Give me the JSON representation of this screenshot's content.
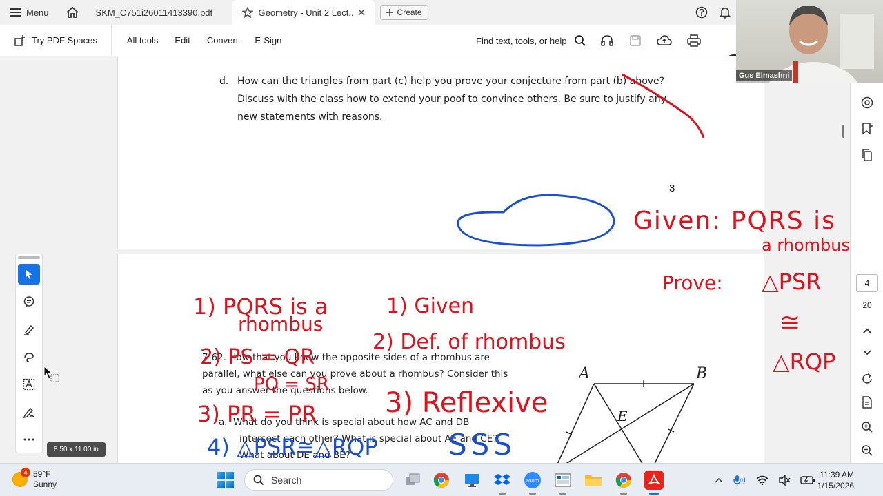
{
  "tabbar": {
    "menu_label": "Menu",
    "tab1_title": "SKM_C751i26011413390.pdf",
    "tab2_title": "Geometry - Unit 2 Lect...",
    "create_label": "Create"
  },
  "toolbar": {
    "try_spaces": "Try PDF Spaces",
    "all_tools": "All tools",
    "edit": "Edit",
    "convert": "Convert",
    "esign": "E-Sign",
    "find": "Find text, tools, or help"
  },
  "document": {
    "q_d_letter": "d.",
    "q_d_text": "How can the triangles from part (c) help you prove your conjecture from part (b) above?  Discuss with the class how to extend your poof to convince others.  Be sure to justify any new statements with reasons.",
    "page_number": "3",
    "q62_line1": "7-62.  How that you know the opposite sides of a rhombus are",
    "q62_line2": "parallel, what else can you prove about a rhombus?  Consider this",
    "q62_line3": "as you answer the questions below.",
    "qa_letter": "a.",
    "qa_line1": "What do you think is special about how AC and DB",
    "qa_line2": "intersect each other?  What is special about AE and CE?",
    "qa_line3": "What about DE and BE?",
    "fig_labels": [
      "A",
      "B",
      "E"
    ]
  },
  "ink": {
    "red_given": "Given: PQRS is",
    "red_rhombus": "a rhombus",
    "red_prove": "Prove:",
    "red_tri1": "△PSR",
    "red_congruent": "≅",
    "red_tri2": "△RQP",
    "red_s1": "1) PQRS is a",
    "red_s1b": "rhombus",
    "red_r1": "1) Given",
    "red_s2": "2) PS = QR",
    "red_s2b": "PQ = SR",
    "red_r2": "2) Def. of rhombus",
    "red_s3": "3) PR = PR",
    "red_r3": "3) Reflexive",
    "blue_s4": "4) △PSR≅△RQP",
    "blue_r4": "SSS",
    "colors": {
      "red": "#e0101c",
      "blue": "#1a4fd1"
    }
  },
  "sidebar_tools": [
    "select-tool",
    "comment-tool",
    "highlight-tool",
    "draw-tool",
    "text-select-tool",
    "sign-tool",
    "more-tools"
  ],
  "size_badge": "8.50 x 11.00 in",
  "right_rail": {
    "current_page": "4",
    "total_pages": "20"
  },
  "webcam": {
    "name": "Gus Elmashni"
  },
  "taskbar": {
    "weather_temp": "59°F",
    "weather_desc": "Sunny",
    "weather_badge": "4",
    "search_placeholder": "Search",
    "time": "11:39 AM",
    "date": "1/15/2026"
  }
}
